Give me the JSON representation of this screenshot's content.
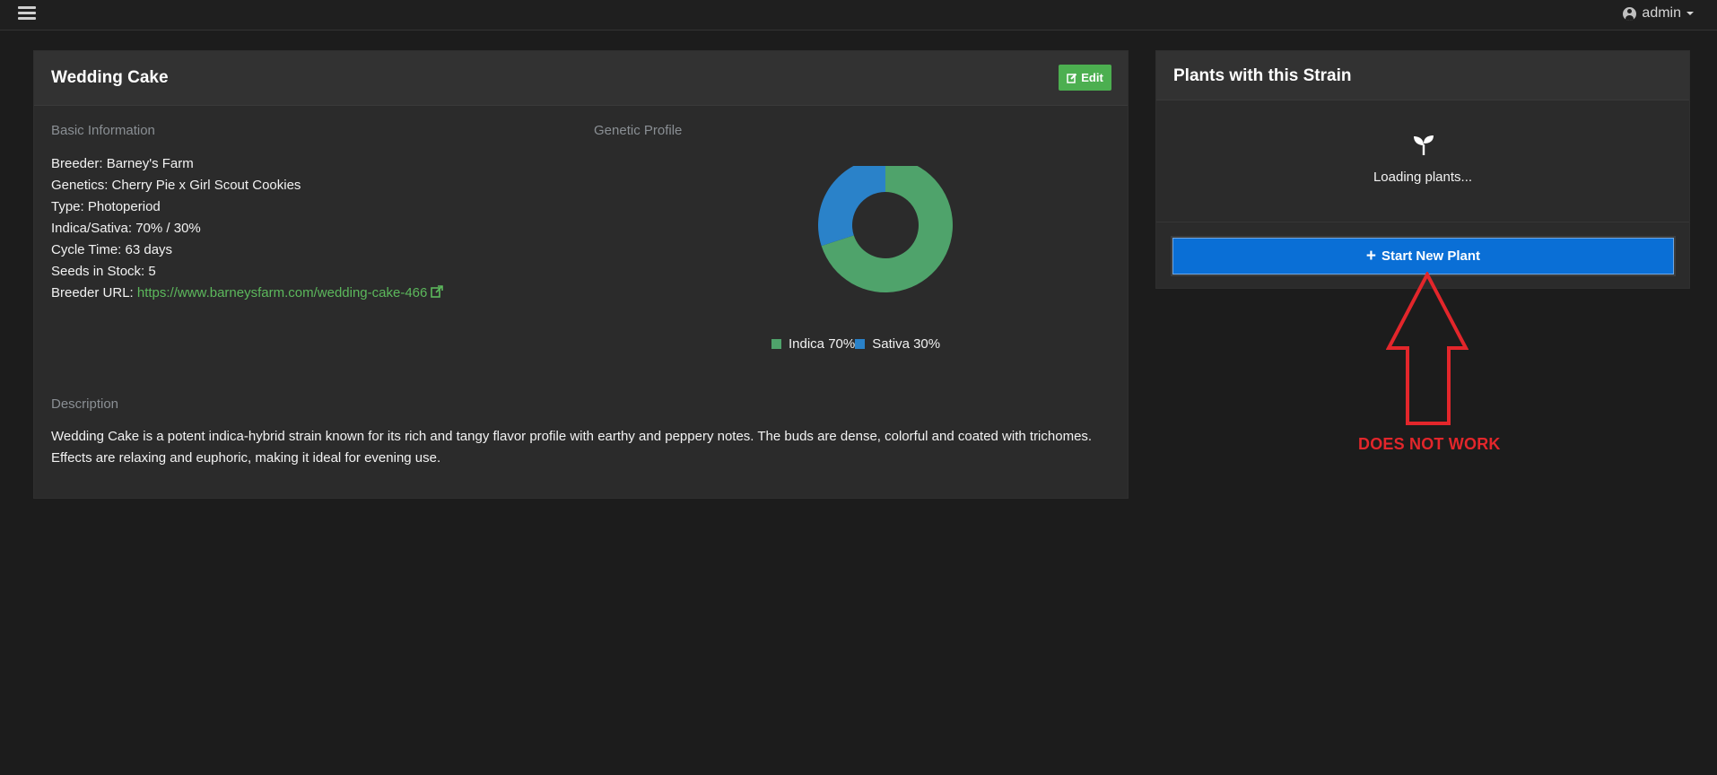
{
  "topbar": {
    "menu_icon": "hamburger-menu-icon",
    "user": {
      "icon": "user-circle-icon",
      "name": "admin"
    }
  },
  "strain": {
    "title": "Wedding Cake",
    "edit_label": "Edit",
    "basic_info_label": "Basic Information",
    "genetic_profile_label": "Genetic Profile",
    "info": {
      "breeder": "Breeder: Barney's Farm",
      "genetics": "Genetics: Cherry Pie x Girl Scout Cookies",
      "type": "Type: Photoperiod",
      "ratio": "Indica/Sativa: 70% / 30%",
      "cycle": "Cycle Time: 63 days",
      "seeds": "Seeds in Stock: 5",
      "url_label": "Breeder URL: ",
      "url": "https://www.barneysfarm.com/wedding-cake-466"
    },
    "description_label": "Description",
    "description": "Wedding Cake is a potent indica-hybrid strain known for its rich and tangy flavor profile with earthy and peppery notes. The buds are dense, colorful and coated with trichomes. Effects are relaxing and euphoric, making it ideal for evening use."
  },
  "chart_data": {
    "type": "pie",
    "categories": [
      "Indica",
      "Sativa"
    ],
    "values": [
      70,
      30
    ],
    "legend_labels": [
      "Indica 70%",
      "Sativa 30%"
    ],
    "colors": [
      "#4fa36b",
      "#2a82c9"
    ],
    "legend": "bottom"
  },
  "plants": {
    "title": "Plants with this Strain",
    "loading_icon": "seedling-icon",
    "loading_text": "Loading plants...",
    "start_button_label": "Start New Plant"
  },
  "annotation": {
    "text": "DOES NOT WORK",
    "color": "#e3262b"
  }
}
